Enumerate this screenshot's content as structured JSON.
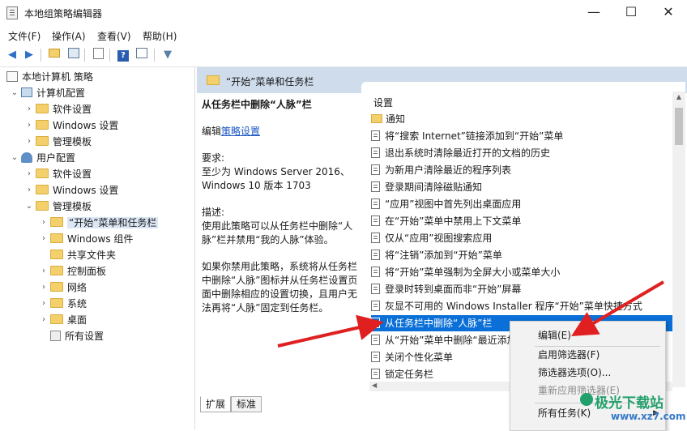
{
  "window": {
    "title": "本地组策略编辑器",
    "minimize_glyph": "—",
    "maximize_glyph": "☐",
    "close_glyph": "✕"
  },
  "menu": [
    "文件(F)",
    "操作(A)",
    "查看(V)",
    "帮助(H)"
  ],
  "toolbar": {
    "icons": [
      "back-icon",
      "forward-icon",
      "up-folder-icon",
      "show-tree-icon",
      "export-icon",
      "help-icon",
      "properties-icon",
      "filter-icon"
    ]
  },
  "tree": {
    "root": "本地计算机 策略",
    "computer": "计算机配置",
    "computer_children": [
      "软件设置",
      "Windows 设置",
      "管理模板"
    ],
    "user": "用户配置",
    "user_children": [
      "软件设置",
      "Windows 设置",
      "管理模板"
    ],
    "admin_children": [
      "“开始”菜单和任务栏",
      "Windows 组件",
      "共享文件夹",
      "控制面板",
      "网络",
      "系统",
      "桌面",
      "所有设置"
    ]
  },
  "right_header": {
    "title": "“开始”菜单和任务栏"
  },
  "description": {
    "heading": "从任务栏中删除“人脉”栏",
    "edit_prefix": "编辑",
    "edit_link": "策略设置",
    "requirements_label": "要求:",
    "requirements_text": "至少为 Windows Server 2016、Windows 10 版本 1703",
    "desc_label": "描述:",
    "desc_text": "使用此策略可以从任务栏中删除“人脉”栏并禁用“我的人脉”体验。",
    "extra_text": "如果你禁用此策略，系统将从任务栏中删除“人脉”图标并从任务栏设置页面中删除相应的设置切换，且用户无法再将“人脉”固定到任务栏。"
  },
  "settings_list": {
    "header": "设置",
    "folder_item": "通知",
    "items": [
      "将“搜索 Internet”链接添加到“开始”菜单",
      "退出系统时清除最近打开的文档的历史",
      "为新用户清除最近的程序列表",
      "登录期间清除磁贴通知",
      "“应用”视图中首先列出桌面应用",
      "在“开始”菜单中禁用上下文菜单",
      "仅从“应用”视图搜索应用",
      "将“注销”添加到“开始”菜单",
      "将“开始”菜单强制为全屏大小或菜单大小",
      "登录时转到桌面而非“开始”屏幕",
      "灰显不可用的 Windows Installer 程序“开始”菜单快捷方式",
      "从任务栏中删除“人脉”栏",
      "从“开始”菜单中删除“最近添加”",
      "关闭个性化菜单",
      "锁定任务栏"
    ]
  },
  "tabs": [
    "扩展",
    "标准"
  ],
  "context_menu": {
    "edit": "编辑(E)",
    "enable_filter": "启用筛选器(F)",
    "filter_options": "筛选器选项(O)...",
    "reapply_filter": "重新应用筛选器(E)",
    "all_tasks": "所有任务(K)"
  },
  "watermark": {
    "name": "极光下载站",
    "url": "www.xz7.com"
  },
  "colors": {
    "selection": "#0a6fd6",
    "header_band": "#cfdcec",
    "annotation_arrow": "#e02020"
  }
}
